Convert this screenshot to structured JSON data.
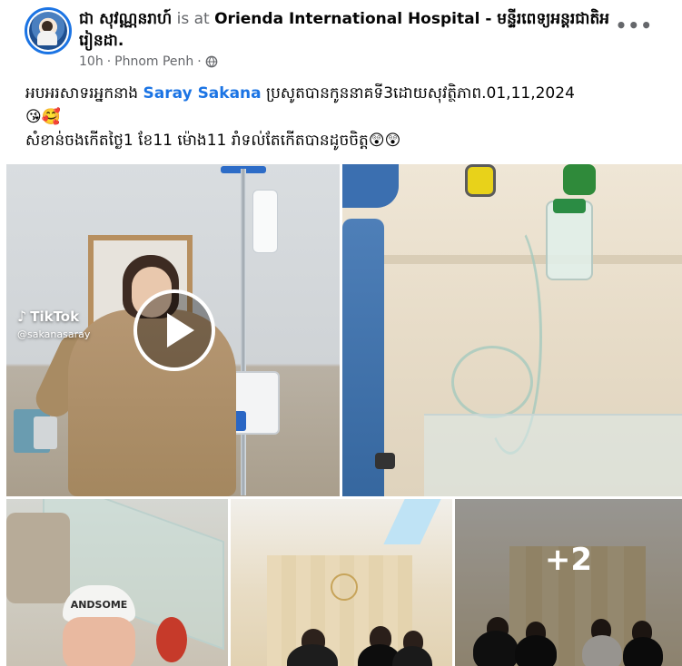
{
  "post": {
    "author": "ជា សុវណ្ណនរាហ៍",
    "is_at": "is at",
    "place": "Orienda International Hospital - មន្ទីរពេទ្យអន្តរជាតិអរៀនដា.",
    "time": "10h",
    "separator": "·",
    "location": "Phnom Penh",
    "separator2": "·",
    "privacy_icon": "globe-icon",
    "more_icon": "more-icon",
    "more_label": "•••",
    "message": {
      "line1_prefix": "អបអរសាទរអ្នកនាង ",
      "tag": "Saray Sakana",
      "line1_suffix": " ប្រសូតបានកូននាគទី3ដោយសុវត្ថិភាព.01,11,2024",
      "line2_emoji": "😘🥰",
      "line3": "សំខាន់ចងកេីតថ្ងៃ1 ខែ11 ម៉ោង11 រាំទល់តែកេីតបានដូចចិត្ត",
      "line3_emoji": "😲😲"
    }
  },
  "photos": {
    "video": {
      "tiktok_brand": "TikTok",
      "tiktok_user": "@sakanasaray",
      "play_icon": "play-icon"
    },
    "baby_hat_text": "ANDSOME",
    "more_count": "+2"
  }
}
